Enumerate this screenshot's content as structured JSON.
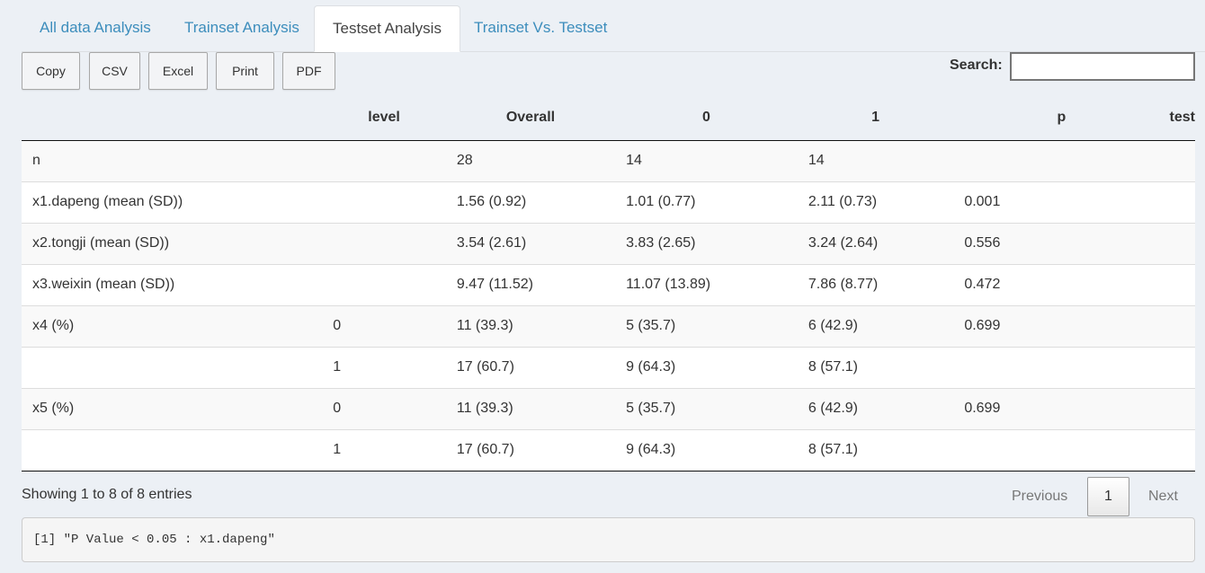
{
  "tabs": [
    {
      "label": "All data Analysis",
      "active": false
    },
    {
      "label": "Trainset Analysis",
      "active": false
    },
    {
      "label": "Testset Analysis",
      "active": true
    },
    {
      "label": "Trainset Vs. Testset",
      "active": false
    }
  ],
  "buttons": {
    "copy": "Copy",
    "csv": "CSV",
    "excel": "Excel",
    "print": "Print",
    "pdf": "PDF"
  },
  "search": {
    "label": "Search:",
    "value": "",
    "placeholder": ""
  },
  "table": {
    "headers": [
      "",
      "level",
      "Overall",
      "0",
      "1",
      "p",
      "test"
    ],
    "rows": [
      [
        "n",
        "",
        "28",
        "14",
        "14",
        "",
        ""
      ],
      [
        "x1.dapeng (mean (SD))",
        "",
        "1.56 (0.92)",
        "1.01 (0.77)",
        "2.11 (0.73)",
        "0.001",
        ""
      ],
      [
        "x2.tongji (mean (SD))",
        "",
        "3.54 (2.61)",
        "3.83 (2.65)",
        "3.24 (2.64)",
        "0.556",
        ""
      ],
      [
        "x3.weixin (mean (SD))",
        "",
        "9.47 (11.52)",
        "11.07 (13.89)",
        "7.86 (8.77)",
        "0.472",
        ""
      ],
      [
        "x4 (%)",
        "0",
        "11 (39.3)",
        "5 (35.7)",
        "6 (42.9)",
        "0.699",
        ""
      ],
      [
        "",
        "1",
        "17 (60.7)",
        "9 (64.3)",
        "8 (57.1)",
        "",
        ""
      ],
      [
        "x5 (%)",
        "0",
        "11 (39.3)",
        "5 (35.7)",
        "6 (42.9)",
        "0.699",
        ""
      ],
      [
        "",
        "1",
        "17 (60.7)",
        "9 (64.3)",
        "8 (57.1)",
        "",
        ""
      ]
    ]
  },
  "info": "Showing 1 to 8 of 8 entries",
  "pagination": {
    "previous": "Previous",
    "current": "1",
    "next": "Next"
  },
  "console_output": "[1] \"P Value < 0.05 : x1.dapeng\""
}
